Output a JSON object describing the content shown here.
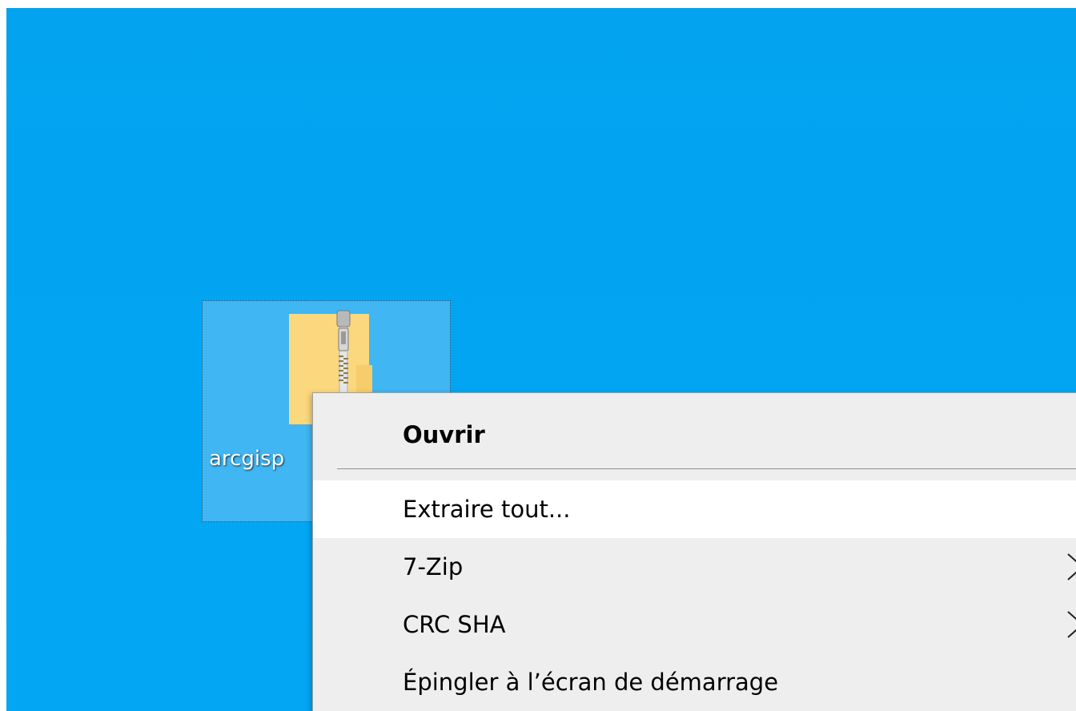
{
  "desktop": {
    "background_color": "#02a5f2",
    "icon": {
      "label": "arcgisp",
      "icon_name": "zip-folder-icon",
      "selected": true
    }
  },
  "context_menu": {
    "items": [
      {
        "label": "Ouvrir",
        "bold": true,
        "has_submenu": false
      },
      {
        "label": "Extraire tout...",
        "bold": false,
        "has_submenu": false,
        "highlighted": true
      },
      {
        "label": "7-Zip",
        "bold": false,
        "has_submenu": true
      },
      {
        "label": "CRC SHA",
        "bold": false,
        "has_submenu": true
      },
      {
        "label": "Épingler à l’écran de démarrage",
        "bold": false,
        "has_submenu": false
      }
    ],
    "highlight_color": "#ffffff",
    "menu_background": "#eeeeee"
  }
}
